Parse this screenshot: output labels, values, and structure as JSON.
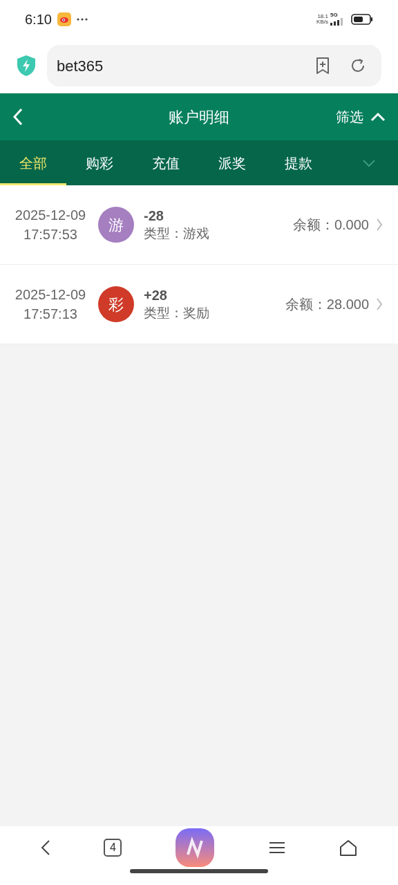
{
  "status_bar": {
    "time": "6:10",
    "speed_value": "18.1",
    "speed_unit": "KB/s",
    "network": "5G"
  },
  "address_bar": {
    "url": "bet365"
  },
  "header": {
    "title": "账户明细",
    "filter_label": "筛选"
  },
  "tabs": [
    {
      "label": "全部",
      "selected": true
    },
    {
      "label": "购彩",
      "selected": false
    },
    {
      "label": "充值",
      "selected": false
    },
    {
      "label": "派奖",
      "selected": false
    },
    {
      "label": "提款",
      "selected": false
    }
  ],
  "records": [
    {
      "date": "2025-12-09",
      "time": "17:57:53",
      "avatar": "游",
      "color": "#a57fc0",
      "amount": "-28",
      "type": "类型：游戏",
      "balance": "余额：0.000"
    },
    {
      "date": "2025-12-09",
      "time": "17:57:13",
      "avatar": "彩",
      "color": "#cf3b28",
      "amount": "+28",
      "type": "类型：奖励",
      "balance": "余额：28.000"
    }
  ],
  "bottom_nav": {
    "tab_count": "4"
  }
}
